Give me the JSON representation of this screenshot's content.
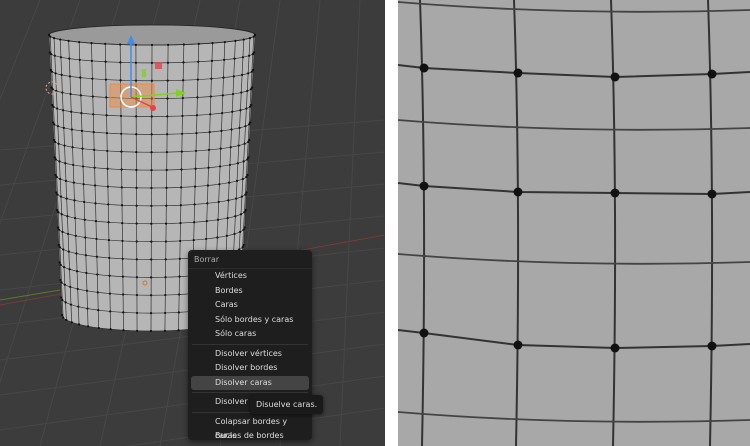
{
  "menu": {
    "title": "Borrar",
    "groups": [
      [
        "Vértices",
        "Bordes",
        "Caras",
        "Sólo bordes y caras",
        "Sólo caras"
      ],
      [
        "Disolver vértices",
        "Disolver bordes",
        "Disolver caras"
      ],
      [
        "Disolver li"
      ],
      [
        "Colapsar bordes y caras",
        "Bucles de bordes"
      ]
    ],
    "active": "Disolver caras"
  },
  "tooltip": "Disuelve caras.",
  "colors": {
    "viewport": "#3c3c3c",
    "mesh": "#b4b4b4",
    "selection": "#f08a3c",
    "axis_x": "#e8404a",
    "axis_y": "#7ed321",
    "axis_z": "#3d8ef0"
  }
}
